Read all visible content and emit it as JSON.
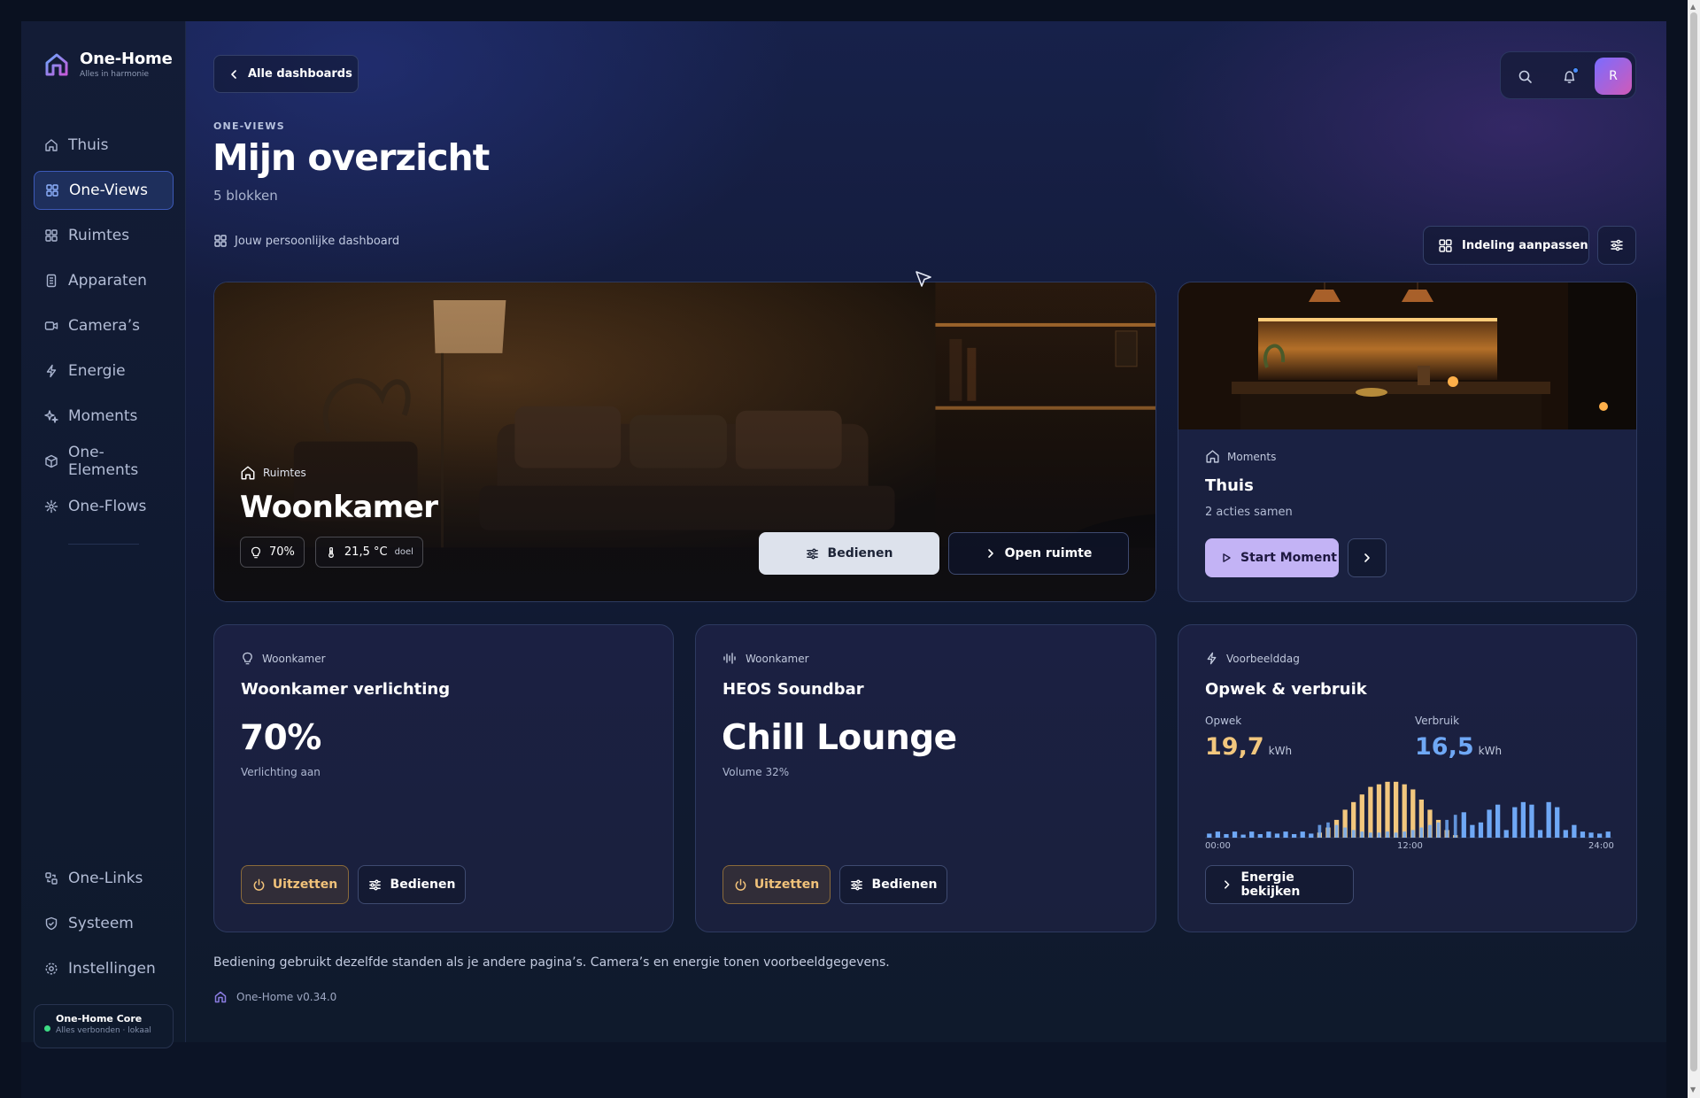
{
  "brand": {
    "name": "One-Home",
    "tagline": "Alles in harmonie"
  },
  "sidebar": {
    "items": [
      {
        "label": "Thuis",
        "icon": "home-icon"
      },
      {
        "label": "One-Views",
        "icon": "grid-icon",
        "active": true
      },
      {
        "label": "Ruimtes",
        "icon": "grid-icon"
      },
      {
        "label": "Apparaten",
        "icon": "device-icon"
      },
      {
        "label": "Camera’s",
        "icon": "camera-icon"
      },
      {
        "label": "Energie",
        "icon": "bolt-icon"
      },
      {
        "label": "Moments",
        "icon": "sparkle-icon"
      },
      {
        "label": "One-Elements",
        "icon": "cube-icon"
      },
      {
        "label": "One-Flows",
        "icon": "flow-icon"
      }
    ],
    "bottom_items": [
      {
        "label": "One-Links",
        "icon": "links-icon"
      },
      {
        "label": "Systeem",
        "icon": "shield-icon"
      },
      {
        "label": "Instellingen",
        "icon": "gear-icon"
      }
    ],
    "core": {
      "title": "One-Home Core",
      "status": "Alles verbonden · lokaal",
      "status_color": "#3ddc84"
    }
  },
  "header": {
    "back_label": "Alle dashboards",
    "avatar_initial": "R",
    "eyebrow": "ONE-VIEWS",
    "title": "Mijn overzicht",
    "subtitle": "5 blokken",
    "dashboard_label": "Jouw persoonlijke dashboard",
    "layout_button": "Indeling aanpassen"
  },
  "hero": {
    "category": "Ruimtes",
    "title": "Woonkamer",
    "light_level": "70%",
    "temperature": "21,5 °C",
    "temperature_note": "doel",
    "control_button": "Bedienen",
    "open_button": "Open ruimte"
  },
  "moment": {
    "category": "Moments",
    "title": "Thuis",
    "subtitle": "2 acties samen",
    "start_button": "Start Moment"
  },
  "lighting": {
    "room": "Woonkamer",
    "title": "Woonkamer verlichting",
    "value": "70%",
    "status": "Verlichting aan",
    "off_button": "Uitzetten",
    "control_button": "Bedienen"
  },
  "soundbar": {
    "room": "Woonkamer",
    "title": "HEOS Soundbar",
    "value": "Chill Lounge",
    "status": "Volume 32%",
    "off_button": "Uitzetten",
    "control_button": "Bedienen"
  },
  "energy": {
    "category": "Voorbeelddag",
    "title": "Opwek & verbruik",
    "production_label": "Opwek",
    "production_value": "19,7",
    "consumption_label": "Verbruik",
    "consumption_value": "16,5",
    "unit": "kWh",
    "button": "Energie bekijken"
  },
  "colors": {
    "production": "#f2c77e",
    "consumption": "#6fa8f5",
    "accent": "#3d5ab8"
  },
  "chart_data": {
    "type": "bar",
    "x_ticks": [
      "00:00",
      "12:00",
      "24:00"
    ],
    "series": [
      {
        "name": "Opwek",
        "values": [
          0,
          0,
          0,
          0,
          0,
          0,
          0,
          0,
          0,
          0,
          0,
          0,
          0,
          0.1,
          0.2,
          0.35,
          0.55,
          0.7,
          0.85,
          1.0,
          1.05,
          1.1,
          1.1,
          1.05,
          0.95,
          0.75,
          0.55,
          0.35,
          0.15,
          0.05,
          0,
          0,
          0,
          0,
          0,
          0,
          0,
          0,
          0,
          0,
          0,
          0,
          0,
          0,
          0,
          0,
          0,
          0
        ]
      },
      {
        "name": "Verbruik",
        "values": [
          0.08,
          0.12,
          0.07,
          0.12,
          0.06,
          0.12,
          0.07,
          0.12,
          0.08,
          0.12,
          0.07,
          0.12,
          0.08,
          0.25,
          0.3,
          0.25,
          0.2,
          0.15,
          0.12,
          0.1,
          0.1,
          0.12,
          0.1,
          0.12,
          0.15,
          0.2,
          0.25,
          0.3,
          0.35,
          0.45,
          0.5,
          0.25,
          0.3,
          0.55,
          0.65,
          0.15,
          0.6,
          0.7,
          0.65,
          0.15,
          0.7,
          0.6,
          0.15,
          0.25,
          0.12,
          0.1,
          0.08,
          0.12
        ]
      }
    ]
  },
  "footer": {
    "note": "Bediening gebruikt dezelfde standen als je andere pagina’s. Camera’s en energie tonen voorbeeldgegevens.",
    "version": "One-Home v0.34.0"
  }
}
